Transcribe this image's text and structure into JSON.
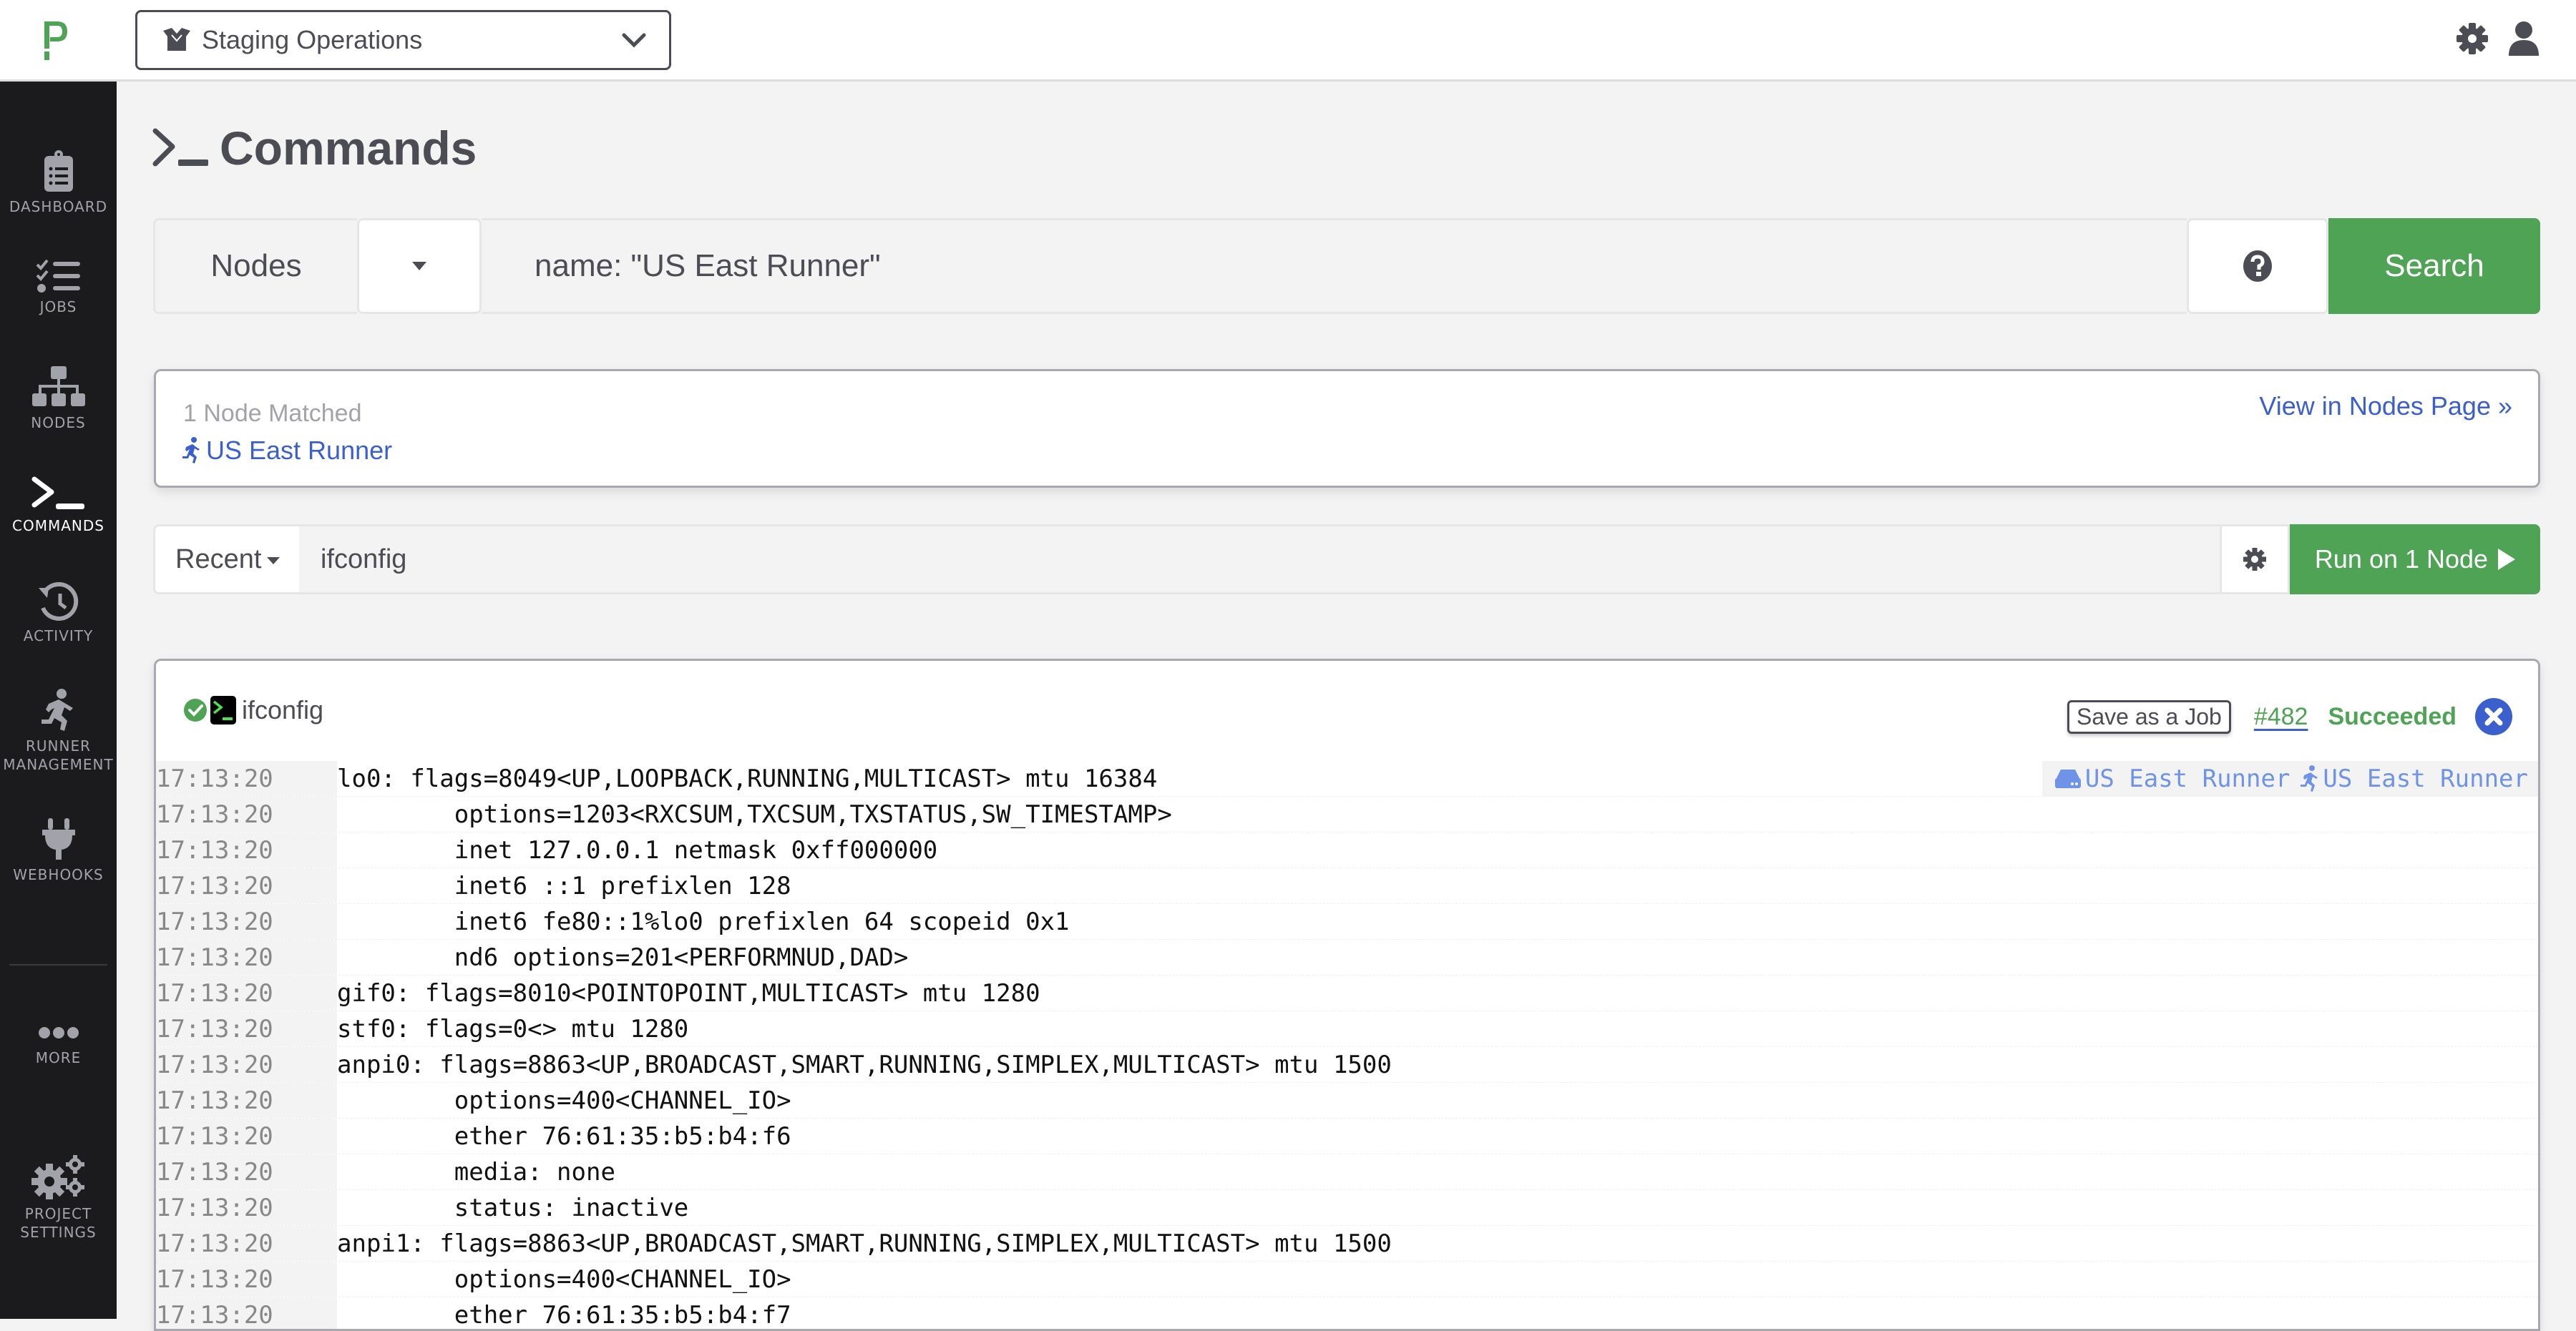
{
  "topbar": {
    "project": "Staging Operations",
    "logo_icon": "pagerduty-p-logo",
    "icons": [
      "gear-icon",
      "user-icon"
    ]
  },
  "sidebar": {
    "items": [
      {
        "label": "DASHBOARD",
        "icon": "clipboard-list-icon",
        "active": false
      },
      {
        "label": "JOBS",
        "icon": "tasks-list-icon",
        "active": false
      },
      {
        "label": "NODES",
        "icon": "sitemap-icon",
        "active": false
      },
      {
        "label": "COMMANDS",
        "icon": "terminal-icon",
        "active": true
      },
      {
        "label": "ACTIVITY",
        "icon": "history-icon",
        "active": false
      },
      {
        "label": "RUNNER",
        "label2": "MANAGEMENT",
        "icon": "running-person-icon",
        "active": false
      },
      {
        "label": "WEBHOOKS",
        "icon": "plug-icon",
        "active": false
      },
      {
        "label": "MORE",
        "icon": "ellipsis-icon",
        "active": false
      },
      {
        "label": "PROJECT",
        "label2": "SETTINGS",
        "icon": "cogs-icon",
        "active": false
      }
    ]
  },
  "page": {
    "title": "Commands"
  },
  "node_filter": {
    "type_label": "Nodes",
    "query": "name: \"US East Runner\"",
    "search_label": "Search"
  },
  "match": {
    "count_text": "1 Node Matched",
    "node_name": "US East Runner",
    "view_link": "View in Nodes Page »"
  },
  "command_bar": {
    "recent_label": "Recent",
    "command": "ifconfig",
    "run_label": "Run on 1 Node"
  },
  "result": {
    "command": "ifconfig",
    "save_label": "Save as a Job",
    "execution_id": "#482",
    "status": "Succeeded",
    "node_tag_1": "US East Runner",
    "node_tag_2": "US East Runner",
    "colors": {
      "success": "#4fa354",
      "link": "#3b5fcc"
    },
    "log": [
      {
        "time": "17:13:20",
        "text": "lo0: flags=8049<UP,LOOPBACK,RUNNING,MULTICAST> mtu 16384"
      },
      {
        "time": "17:13:20",
        "text": "\toptions=1203<RXCSUM,TXCSUM,TXSTATUS,SW_TIMESTAMP>"
      },
      {
        "time": "17:13:20",
        "text": "\tinet 127.0.0.1 netmask 0xff000000"
      },
      {
        "time": "17:13:20",
        "text": "\tinet6 ::1 prefixlen 128"
      },
      {
        "time": "17:13:20",
        "text": "\tinet6 fe80::1%lo0 prefixlen 64 scopeid 0x1"
      },
      {
        "time": "17:13:20",
        "text": "\tnd6 options=201<PERFORMNUD,DAD>"
      },
      {
        "time": "17:13:20",
        "text": "gif0: flags=8010<POINTOPOINT,MULTICAST> mtu 1280"
      },
      {
        "time": "17:13:20",
        "text": "stf0: flags=0<> mtu 1280"
      },
      {
        "time": "17:13:20",
        "text": "anpi0: flags=8863<UP,BROADCAST,SMART,RUNNING,SIMPLEX,MULTICAST> mtu 1500"
      },
      {
        "time": "17:13:20",
        "text": "\toptions=400<CHANNEL_IO>"
      },
      {
        "time": "17:13:20",
        "text": "\tether 76:61:35:b5:b4:f6"
      },
      {
        "time": "17:13:20",
        "text": "\tmedia: none"
      },
      {
        "time": "17:13:20",
        "text": "\tstatus: inactive"
      },
      {
        "time": "17:13:20",
        "text": "anpi1: flags=8863<UP,BROADCAST,SMART,RUNNING,SIMPLEX,MULTICAST> mtu 1500"
      },
      {
        "time": "17:13:20",
        "text": "\toptions=400<CHANNEL_IO>"
      },
      {
        "time": "17:13:20",
        "text": "\tether 76:61:35:b5:b4:f7"
      }
    ]
  }
}
